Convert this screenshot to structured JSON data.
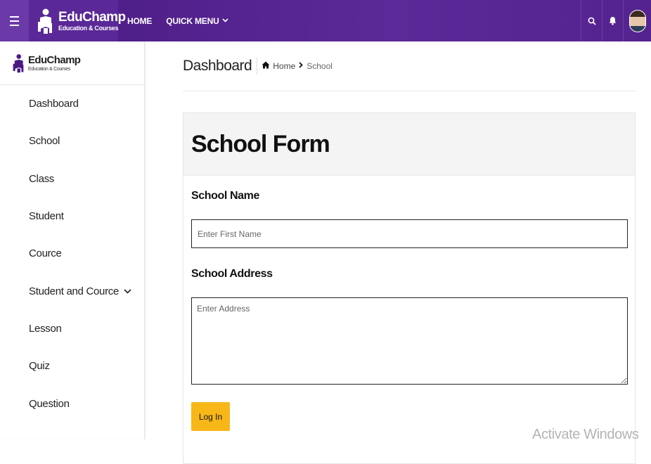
{
  "header": {
    "brand_name": "EduChamp",
    "brand_tagline": "Education & Courses",
    "nav": [
      {
        "label": "HOME"
      },
      {
        "label": "QUICK MENU"
      }
    ],
    "icons": [
      "menu-icon",
      "search-icon",
      "bell-icon",
      "avatar"
    ],
    "accent": "#4a1a83"
  },
  "sidebar": {
    "brand_name": "EduChamp",
    "brand_tagline": "Education & Courses",
    "items": [
      {
        "label": "Dashboard"
      },
      {
        "label": "School"
      },
      {
        "label": "Class"
      },
      {
        "label": "Student"
      },
      {
        "label": "Cource"
      },
      {
        "label": "Student and Cource",
        "has_submenu": true
      },
      {
        "label": "Lesson"
      },
      {
        "label": "Quiz"
      },
      {
        "label": "Question"
      }
    ]
  },
  "main": {
    "page_title": "Dashboard",
    "breadcrumb": {
      "home": "Home",
      "current": "School"
    },
    "form": {
      "title": "School Form",
      "name_label": "School Name",
      "name_placeholder": "Enter First Name",
      "name_value": "",
      "address_label": "School Address",
      "address_placeholder": "Enter Address",
      "address_value": "",
      "submit_label": "Log In",
      "submit_color": "#f8b719"
    }
  },
  "overlay": {
    "watermark": "Activate Windows"
  }
}
